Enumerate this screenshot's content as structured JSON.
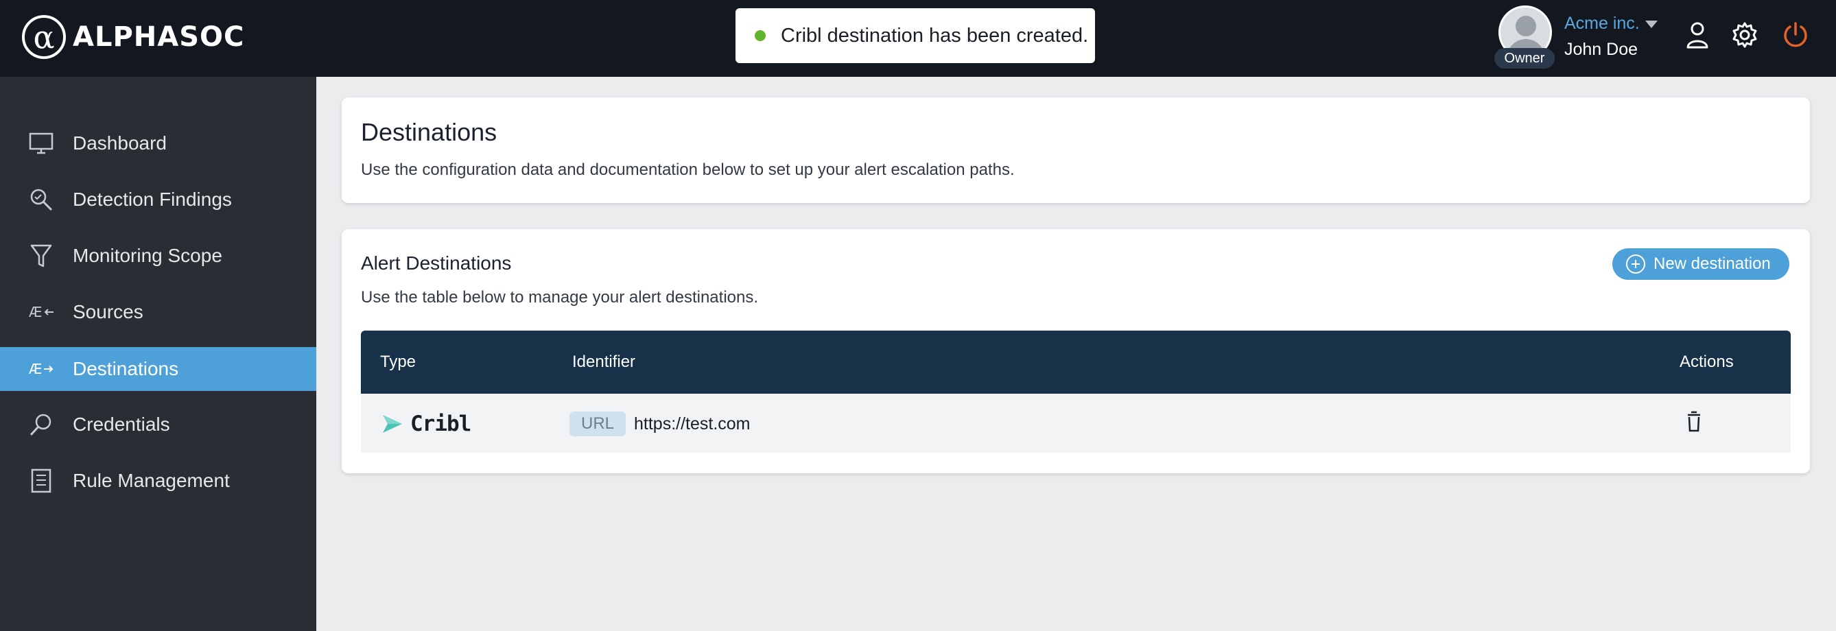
{
  "brand": {
    "logo_glyph": "α",
    "name": "ALPHASOC"
  },
  "toast": {
    "message": "Cribl destination has been created.",
    "status_color": "#62b530"
  },
  "user": {
    "org": "Acme inc.",
    "name": "John Doe",
    "role": "Owner"
  },
  "topbar_icons": [
    "user-profile-icon",
    "gear-icon",
    "power-icon"
  ],
  "sidebar": {
    "items": [
      {
        "label": "Dashboard",
        "icon": "monitor-icon",
        "active": false
      },
      {
        "label": "Detection Findings",
        "icon": "magnifier-icon",
        "active": false
      },
      {
        "label": "Monitoring Scope",
        "icon": "filter-icon",
        "active": false
      },
      {
        "label": "Sources",
        "icon": "sources-icon",
        "active": false
      },
      {
        "label": "Destinations",
        "icon": "destinations-icon",
        "active": true
      },
      {
        "label": "Credentials",
        "icon": "key-search-icon",
        "active": false
      },
      {
        "label": "Rule Management",
        "icon": "checklist-icon",
        "active": false
      }
    ]
  },
  "page": {
    "title": "Destinations",
    "subtitle": "Use the configuration data and documentation below to set up your alert escalation paths."
  },
  "alert_destinations": {
    "title": "Alert Destinations",
    "subtitle": "Use the table below to manage your alert destinations.",
    "new_button": "New destination",
    "columns": [
      "Type",
      "Identifier",
      "Actions"
    ],
    "rows": [
      {
        "type": "Cribl",
        "identifier_tag": "URL",
        "identifier": "https://test.com",
        "action_icon": "trash-icon"
      }
    ]
  },
  "colors": {
    "accent": "#4ea1d8",
    "topbar": "#131820",
    "sidebar": "#2a2d33",
    "table_header": "#173149",
    "power": "#e4622a"
  }
}
